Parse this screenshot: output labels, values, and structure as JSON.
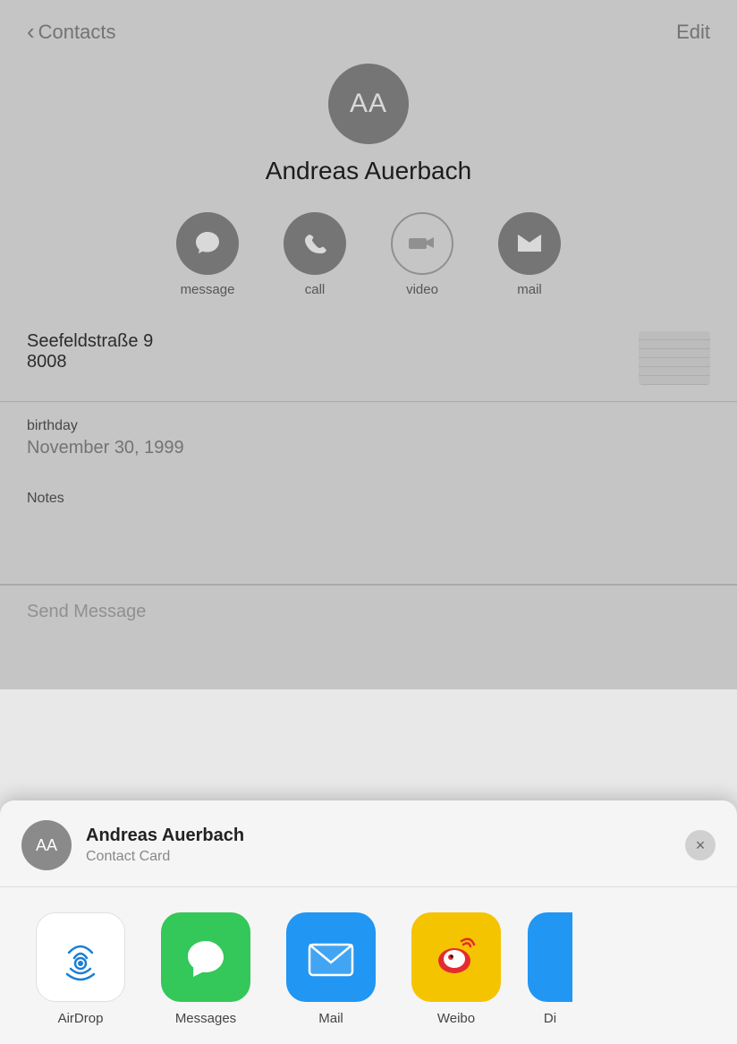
{
  "header": {
    "back_label": "Contacts",
    "edit_label": "Edit"
  },
  "contact": {
    "initials": "AA",
    "name": "Andreas Auerbach"
  },
  "actions": [
    {
      "id": "message",
      "label": "message",
      "enabled": true
    },
    {
      "id": "call",
      "label": "call",
      "enabled": true
    },
    {
      "id": "video",
      "label": "video",
      "enabled": false
    },
    {
      "id": "mail",
      "label": "mail",
      "enabled": true
    }
  ],
  "address": {
    "street": "Seefeldstraße 9",
    "city": "8008"
  },
  "birthday": {
    "label": "birthday",
    "value": "November 30, 1999"
  },
  "notes": {
    "label": "Notes",
    "value": ""
  },
  "send_message": {
    "label": "Send Message"
  },
  "share_sheet": {
    "contact_name": "Andreas Auerbach",
    "contact_sub": "Contact Card",
    "initials": "AA",
    "close_label": "×",
    "apps": [
      {
        "id": "airdrop",
        "label": "AirDrop"
      },
      {
        "id": "messages",
        "label": "Messages"
      },
      {
        "id": "mail",
        "label": "Mail"
      },
      {
        "id": "weibo",
        "label": "Weibo"
      },
      {
        "id": "partial",
        "label": "Di"
      }
    ]
  }
}
